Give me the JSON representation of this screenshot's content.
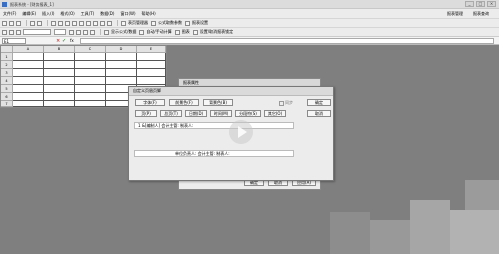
{
  "window": {
    "title": "报表系统 - [财务报表_1]",
    "controls": [
      "_",
      "□",
      "×"
    ]
  },
  "menu": {
    "items": [
      "文件(F)",
      "编辑(E)",
      "插入(I)",
      "格式(O)",
      "工具(T)",
      "数据(D)",
      "窗口(W)",
      "帮助(H)"
    ],
    "right": [
      "报表管理",
      "报表查询"
    ]
  },
  "toolbar1": {
    "dropdown1": "表页管理器",
    "dropdown2": "公式取数参数",
    "dropdown3": "报表设置"
  },
  "toolbar2": {
    "formula_label": "显示公式/数据",
    "calc_label": "自动/手动计算",
    "chart_label": "图表",
    "lock_label": "设置/取消报表锁定"
  },
  "formula_bar": {
    "cell_ref": "E1",
    "value": ""
  },
  "sheet": {
    "columns": [
      "A",
      "B",
      "C",
      "D",
      "E"
    ],
    "rows": [
      "1",
      "2",
      "3",
      "4",
      "5",
      "6",
      "7"
    ]
  },
  "back_dialog": {
    "title": "报表属性",
    "buttons": [
      "确定",
      "取消",
      "应用(A)"
    ]
  },
  "dialog": {
    "title": "自定义页眉页脚",
    "buttons_row1": [
      "字体(F)",
      "前景色(F)",
      "背景色(B)"
    ],
    "buttons_row2": [
      "页(P)",
      "总页(T)",
      "日期(D)",
      "时间(M)",
      "分段符(S)",
      "其它(O)"
    ],
    "checkbox": "同步",
    "ok": "确定",
    "cancel": "取消",
    "header_text": "1 &[编制人] 会计主管: 制表人:",
    "footer_text": "单位负责人: 会计主管: 制表人:"
  }
}
